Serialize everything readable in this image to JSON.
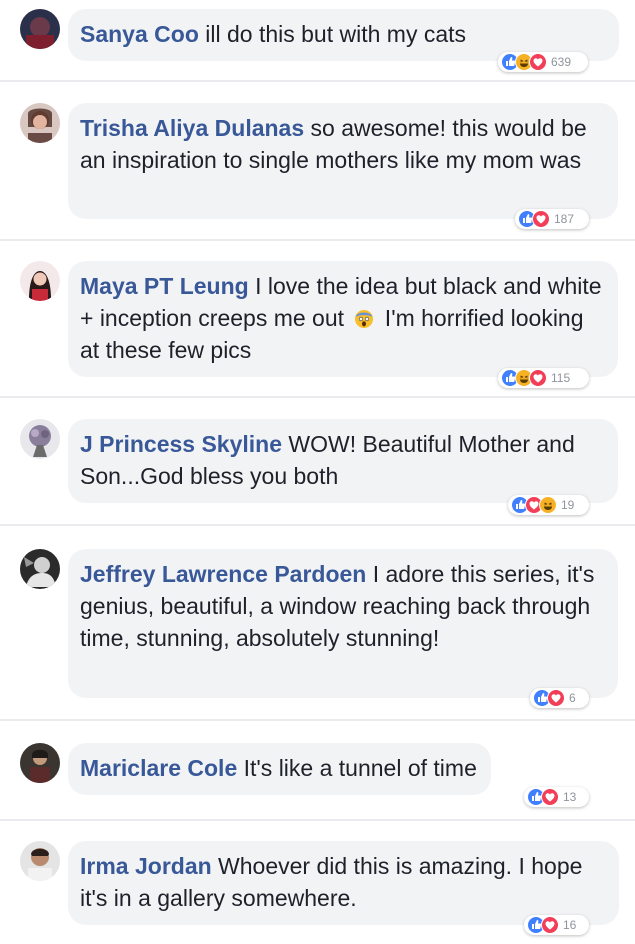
{
  "comments": [
    {
      "author": "Sanya Coo",
      "text": " ill do this but with my cats",
      "reactions": [
        "like",
        "haha",
        "love"
      ],
      "count": "639"
    },
    {
      "author": "Trisha Aliya Dulanas",
      "text": " so awesome! this would be an inspiration to single mothers like my mom was",
      "reactions": [
        "like",
        "love"
      ],
      "count": "187"
    },
    {
      "author": "Maya PT Leung",
      "text_before": " I love the idea but black and white + inception creeps me out ",
      "inline_emoji": "scream-emoji",
      "text_after": " I'm horrified looking at these few pics",
      "reactions": [
        "like",
        "haha",
        "love"
      ],
      "count": "115"
    },
    {
      "author": "J Princess Skyline",
      "text": " WOW! Beautiful Mother and Son...God bless you both",
      "reactions": [
        "like",
        "love",
        "haha"
      ],
      "count": "19"
    },
    {
      "author": "Jeffrey Lawrence Pardoen",
      "text": " I adore this series, it's genius, beautiful, a window reaching back through time, stunning, absolutely stunning!",
      "reactions": [
        "like",
        "love"
      ],
      "count": "6"
    },
    {
      "author": "Mariclare Cole",
      "text": " It's like a tunnel of time",
      "reactions": [
        "like",
        "love"
      ],
      "count": "13"
    },
    {
      "author": "Irma Jordan",
      "text": " Whoever did this is amazing. I hope it's in a gallery somewhere.",
      "reactions": [
        "like",
        "love"
      ],
      "count": "16"
    }
  ],
  "colors": {
    "author": "#385898",
    "bubble": "#f2f3f5",
    "like": "#4080ff",
    "love": "#f33e58",
    "haha": "#f7b125"
  }
}
